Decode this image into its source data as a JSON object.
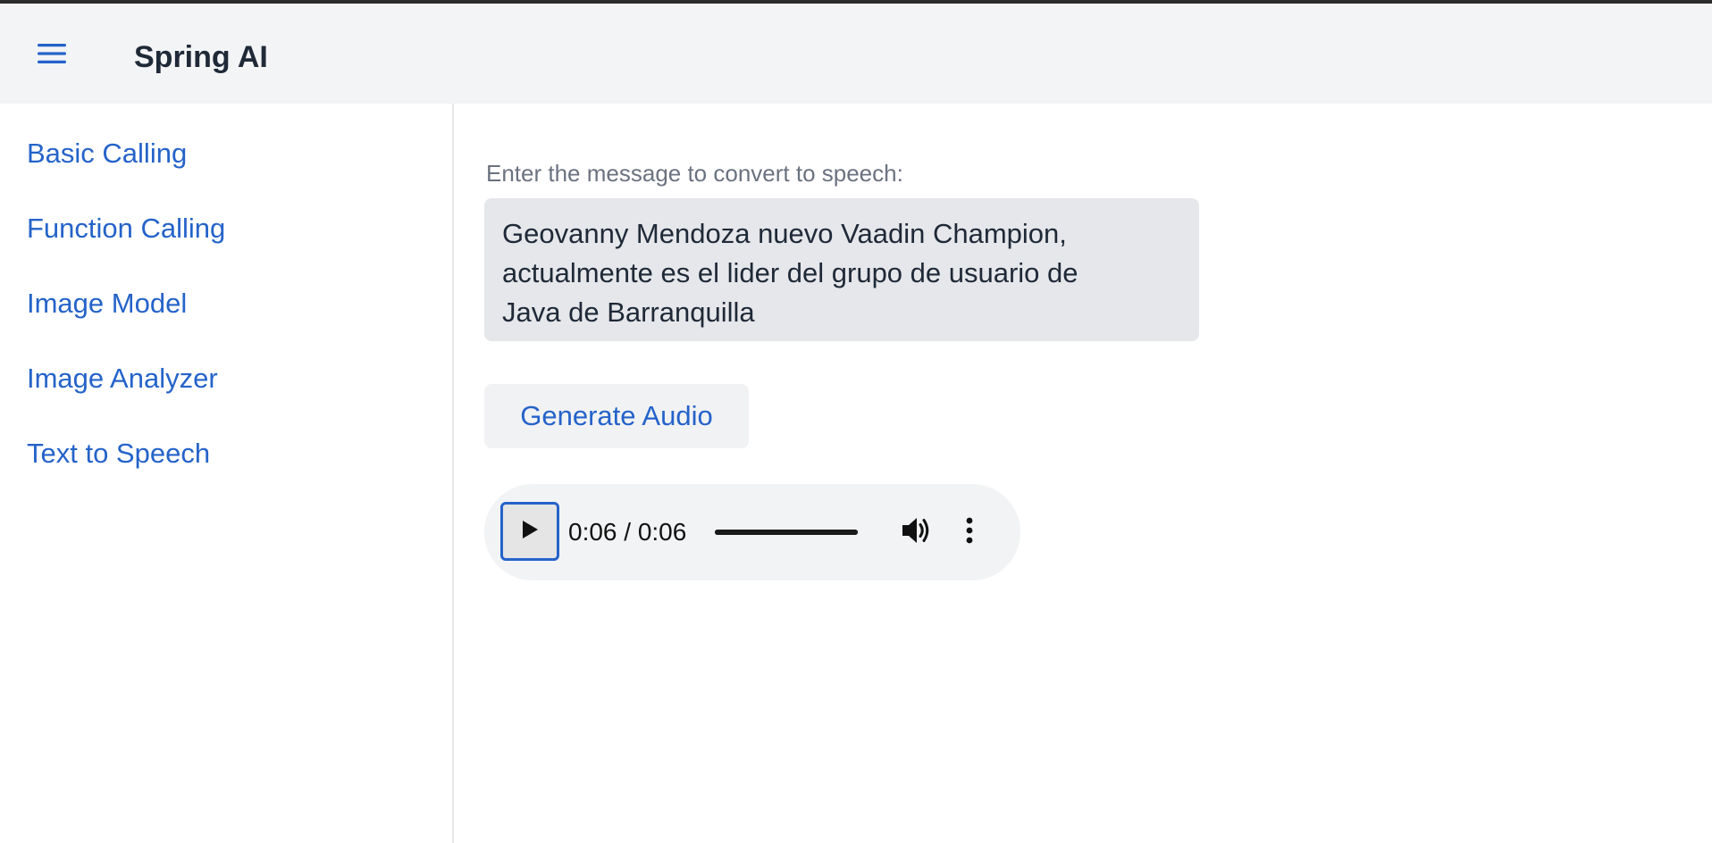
{
  "header": {
    "menu_icon": "hamburger-menu-icon",
    "title": "Spring AI"
  },
  "sidebar": {
    "items": [
      {
        "label": "Basic Calling"
      },
      {
        "label": "Function Calling"
      },
      {
        "label": "Image Model"
      },
      {
        "label": "Image Analyzer"
      },
      {
        "label": "Text to Speech"
      }
    ]
  },
  "main": {
    "message_label": "Enter the message to convert to speech:",
    "message_value": "Geovanny Mendoza nuevo Vaadin Champion,\nactualmente es el lider del grupo de usuario de\nJava de Barranquilla",
    "generate_label": "Generate Audio",
    "audio": {
      "time": "0:06 / 0:06",
      "progress": 1.0,
      "play_icon": "play-icon",
      "volume_icon": "volume-icon",
      "more_icon": "more-vertical-icon"
    }
  },
  "colors": {
    "accent": "#2563c9",
    "header_bg": "#f3f4f6",
    "field_bg": "#e5e7ea",
    "label_gray": "#6b7280"
  }
}
